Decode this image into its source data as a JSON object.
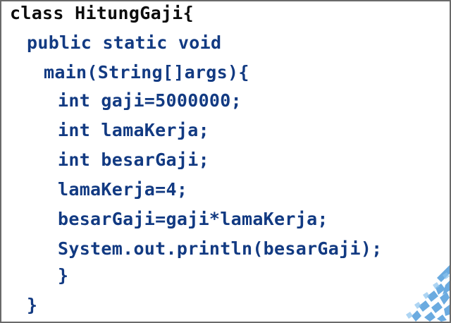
{
  "code": {
    "lines": [
      "class HitungGaji{",
      "public static void",
      "main(String[]args){",
      "int gaji=5000000;",
      "int lamaKerja;",
      "int besarGaji;",
      "lamaKerja=4;",
      "besarGaji=gaji*lamaKerja;",
      "System.out.println(besarGaji);",
      "}",
      "}"
    ]
  },
  "colors": {
    "first_line": "#0d0d0d",
    "code_text": "#123a82",
    "border": "#6a6a6a",
    "corner_accent": "#3a8fd6"
  }
}
